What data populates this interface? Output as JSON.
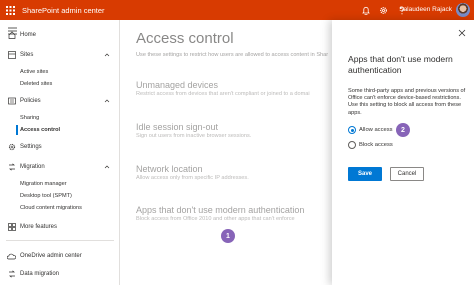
{
  "header": {
    "app_title": "SharePoint admin center",
    "user_name": "Salaudeen Rajack",
    "icons": [
      "waffle-icon",
      "bell-icon",
      "gear-icon",
      "help-icon"
    ],
    "brand_color": "#d83b01"
  },
  "sidebar": {
    "items": [
      {
        "label": "Home"
      },
      {
        "label": "Sites"
      },
      {
        "label": "Active sites"
      },
      {
        "label": "Deleted sites"
      },
      {
        "label": "Policies"
      },
      {
        "label": "Sharing"
      },
      {
        "label": "Access control"
      },
      {
        "label": "Settings"
      },
      {
        "label": "Migration"
      },
      {
        "label": "Migration manager"
      },
      {
        "label": "Desktop tool (SPMT)"
      },
      {
        "label": "Cloud content migrations"
      },
      {
        "label": "More features"
      },
      {
        "label": "OneDrive admin center"
      },
      {
        "label": "Data migration"
      }
    ]
  },
  "main": {
    "title": "Access control",
    "description": "Use these settings to restrict how users are allowed to access content in Shar",
    "settings": [
      {
        "title": "Unmanaged devices",
        "desc": "Restrict access from devices that aren't compliant or joined to a domai"
      },
      {
        "title": "Idle session sign-out",
        "desc": "Sign out users from inactive browser sessions."
      },
      {
        "title": "Network location",
        "desc": "Allow access only from specific IP addresses."
      },
      {
        "title": "Apps that don't use modern authentication",
        "desc": "Block access from Office 2010 and other apps that can't enforce"
      }
    ],
    "callout_1": "1"
  },
  "panel": {
    "title": "Apps that don't use modern authentication",
    "description": "Some third-party apps and previous versions of Office can't enforce device-based restrictions. Use this setting to block all access from these apps.",
    "options": [
      {
        "label": "Allow access",
        "selected": true
      },
      {
        "label": "Block access",
        "selected": false
      }
    ],
    "callout_2": "2",
    "save_label": "Save",
    "cancel_label": "Cancel",
    "accent_color": "#0078d4",
    "callout_color": "#8764b8"
  }
}
